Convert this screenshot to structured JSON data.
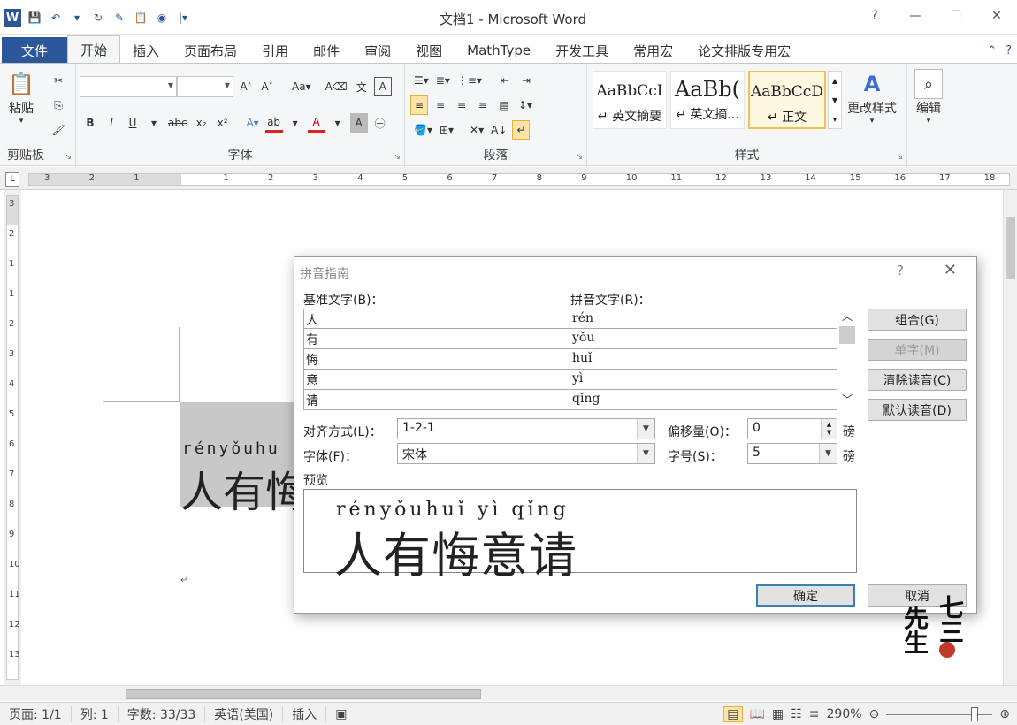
{
  "window": {
    "title": "文档1 - Microsoft Word",
    "controls": [
      "?",
      "—",
      "☐",
      "✕"
    ]
  },
  "qat": {
    "icons": [
      "word-logo-icon",
      "save-icon",
      "undo-icon",
      "redo-icon",
      "format-painter-icon",
      "paste-special-icon",
      "customize-icon"
    ]
  },
  "ribbon_tabs": [
    "文件",
    "开始",
    "插入",
    "页面布局",
    "引用",
    "邮件",
    "审阅",
    "视图",
    "MathType",
    "开发工具",
    "常用宏",
    "论文排版专用宏"
  ],
  "active_tab": "开始",
  "ribbon": {
    "clipboard": {
      "label": "剪贴板",
      "paste": "粘贴"
    },
    "font": {
      "label": "字体",
      "font_name": "",
      "font_size": ""
    },
    "paragraph": {
      "label": "段落"
    },
    "styles": {
      "label": "样式",
      "items": [
        {
          "sample": "AaBbCcI",
          "name": "↵ 英文摘要"
        },
        {
          "sample": "AaBb(",
          "name": "↵ 英文摘..."
        },
        {
          "sample": "AaBbCcD",
          "name": "↵ 正文"
        }
      ],
      "change_styles": "更改样式"
    },
    "editing": {
      "label": "编辑"
    }
  },
  "ruler": {
    "numbers": [
      "3",
      "2",
      "1",
      "",
      "1",
      "2",
      "3",
      "4",
      "5",
      "6",
      "7",
      "8",
      "9",
      "10",
      "11",
      "12",
      "13",
      "14",
      "15",
      "16",
      "17",
      "18"
    ],
    "vnumbers": [
      "3",
      "2",
      "1",
      "1",
      "2",
      "3",
      "4",
      "5",
      "6",
      "7",
      "8",
      "9",
      "10",
      "11",
      "12",
      "13"
    ]
  },
  "document": {
    "pinyin": "rényǒuhu",
    "hanzi": "人有悔",
    "para_mark": "↵"
  },
  "dialog": {
    "title": "拼音指南",
    "help": "?",
    "close": "✕",
    "base_label": "基准文字(B)：",
    "pinyin_label": "拼音文字(R)：",
    "rows": [
      {
        "base": "人",
        "pinyin": "rén"
      },
      {
        "base": "有",
        "pinyin": "yǒu"
      },
      {
        "base": "悔",
        "pinyin": "huǐ"
      },
      {
        "base": "意",
        "pinyin": "yì"
      },
      {
        "base": "请",
        "pinyin": "qǐng"
      }
    ],
    "buttons": {
      "combine": "组合(G)",
      "single": "单字(M)",
      "clear": "清除读音(C)",
      "default": "默认读音(D)",
      "ok": "确定",
      "cancel": "取消"
    },
    "align_label": "对齐方式(L)：",
    "align_value": "1-2-1",
    "offset_label": "偏移量(O)：",
    "offset_value": "0",
    "offset_unit": "磅",
    "font_label": "字体(F)：",
    "font_value": "宋体",
    "size_label": "字号(S)：",
    "size_value": "5",
    "size_unit": "磅",
    "preview_label": "预览",
    "preview_pinyin": "rényǒuhuǐ yì qǐng",
    "preview_hanzi": "人有悔意请"
  },
  "statusbar": {
    "page": "页面: 1/1",
    "column": "列: 1",
    "words": "字数: 33/33",
    "language": "英语(美国)",
    "mode": "插入",
    "zoom": "290%",
    "zoom_level_percent": 290
  },
  "watermark": {
    "chars": [
      "七",
      "先",
      "三",
      "生"
    ]
  }
}
